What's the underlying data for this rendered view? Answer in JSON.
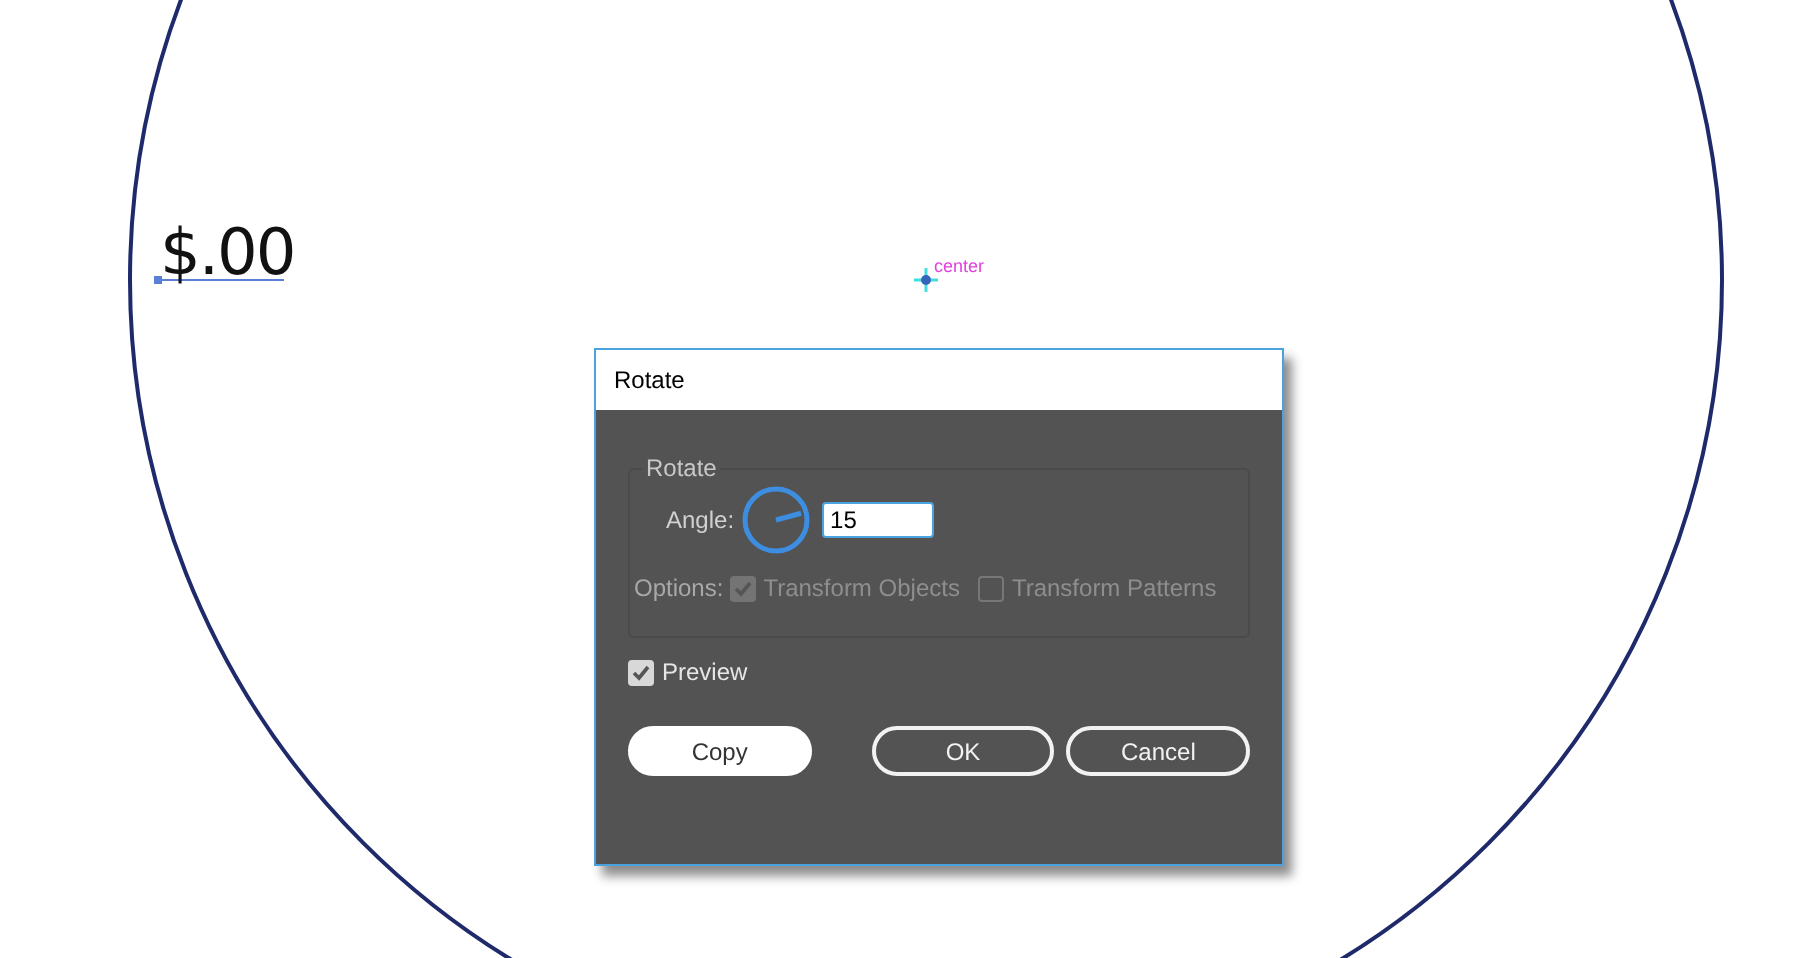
{
  "canvas": {
    "text_object": "$.00",
    "center_label": "center"
  },
  "dialog": {
    "title": "Rotate",
    "group_label": "Rotate",
    "angle_label": "Angle:",
    "angle_value": "15",
    "options_label": "Options:",
    "options": [
      {
        "label": "Transform Objects",
        "checked": true,
        "disabled": true
      },
      {
        "label": "Transform Patterns",
        "checked": false,
        "disabled": true
      }
    ],
    "preview": {
      "label": "Preview",
      "checked": true
    },
    "buttons": [
      {
        "label": "Copy",
        "kind": "filled"
      },
      {
        "label": "OK",
        "kind": "outlined"
      },
      {
        "label": "Cancel",
        "kind": "outlined"
      }
    ]
  }
}
